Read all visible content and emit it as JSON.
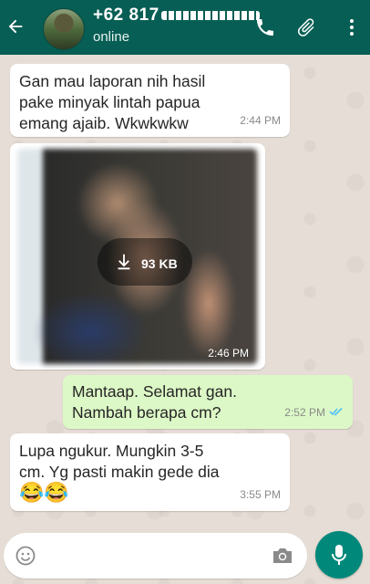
{
  "header": {
    "contact_name": "+62 817",
    "status": "online"
  },
  "messages": [
    {
      "direction": "incoming",
      "text": "Gan mau laporan nih hasil\npake minyak lintah papua\nemang ajaib. Wkwkwkw",
      "time": "2:44 PM"
    },
    {
      "direction": "incoming",
      "type": "image",
      "download_size": "93 KB",
      "time": "2:46 PM"
    },
    {
      "direction": "outgoing",
      "text": "Mantaap. Selamat gan.\nNambah berapa cm?",
      "time": "2:52 PM",
      "status": "read"
    },
    {
      "direction": "incoming",
      "text": "Lupa ngukur. Mungkin 3-5\ncm. Yg pasti makin gede dia",
      "emojis": "😂😂",
      "time": "3:55 PM"
    }
  ],
  "composer": {
    "placeholder": ""
  },
  "colors": {
    "header": "#075e54",
    "outgoing_bubble": "#dcf8c6",
    "incoming_bubble": "#ffffff",
    "read_ticks": "#4fc3f7",
    "mic_button": "#00897b"
  },
  "icons": [
    "back-arrow-icon",
    "phone-icon",
    "paperclip-icon",
    "more-vert-icon",
    "download-icon",
    "read-ticks-icon",
    "emoji-icon",
    "camera-icon",
    "mic-icon"
  ]
}
